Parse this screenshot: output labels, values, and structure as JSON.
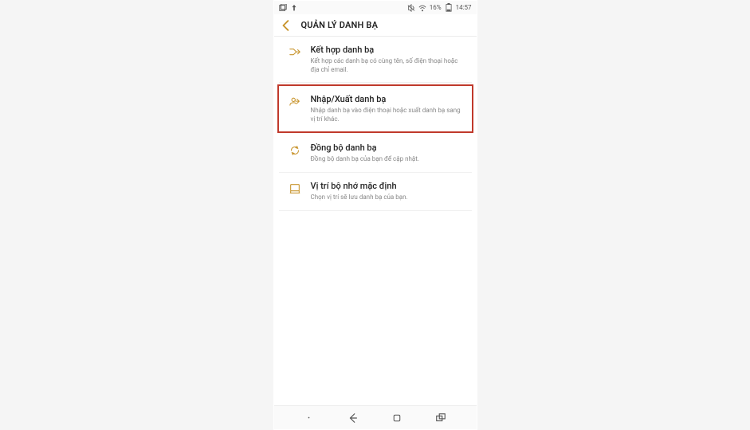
{
  "status": {
    "battery_text": "16%",
    "time": "14:57"
  },
  "header": {
    "title": "QUẢN LÝ DANH BẠ"
  },
  "settings": [
    {
      "icon_name": "merge-icon",
      "title": "Kết hợp danh bạ",
      "desc": "Kết hợp các danh bạ có cùng tên, số điện thoại hoặc địa chỉ email.",
      "highlighted": false
    },
    {
      "icon_name": "import-export-icon",
      "title": "Nhập/Xuất danh bạ",
      "desc": "Nhập danh bạ vào điện thoại hoặc xuất danh bạ sang vị trí khác.",
      "highlighted": true
    },
    {
      "icon_name": "sync-icon",
      "title": "Đồng bộ danh bạ",
      "desc": "Đồng bộ danh bạ của bạn để cập nhật.",
      "highlighted": false
    },
    {
      "icon_name": "storage-icon",
      "title": "Vị trí bộ nhớ mặc định",
      "desc": "Chọn vị trí sẽ lưu danh bạ của bạn.",
      "highlighted": false
    }
  ]
}
